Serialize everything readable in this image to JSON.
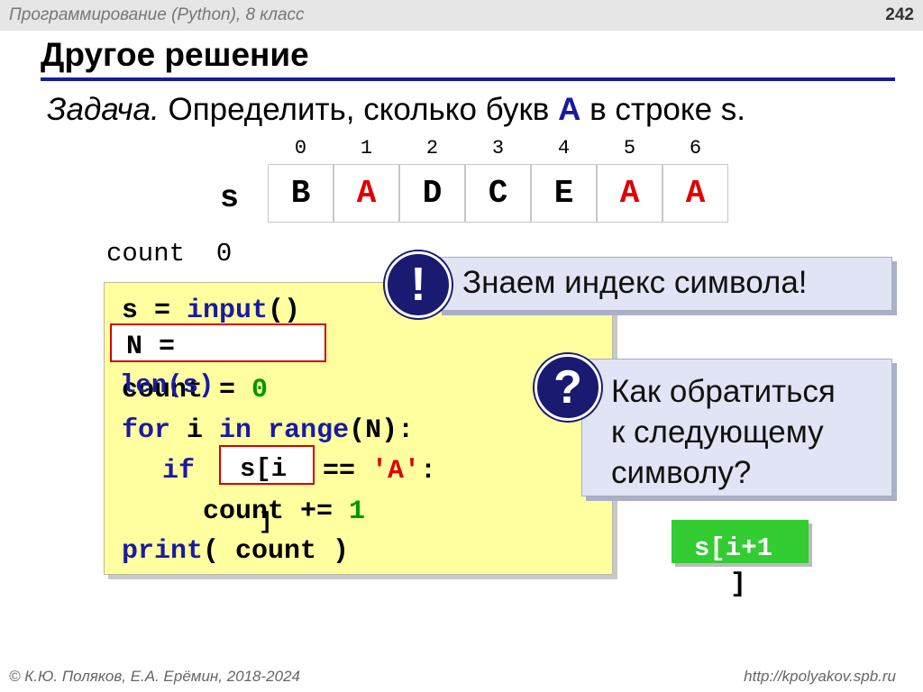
{
  "header": {
    "course": "Программирование (Python), 8 класс",
    "page_number": "242"
  },
  "slide": {
    "title": "Другое решение"
  },
  "task": {
    "lead": "Задача.",
    "text_before": "Определить, сколько букв",
    "letter": "A",
    "text_after": "в строке s."
  },
  "string_table": {
    "label": "s",
    "indices": [
      "0",
      "1",
      "2",
      "3",
      "4",
      "5",
      "6"
    ],
    "cells": [
      {
        "char": "B",
        "highlight": false
      },
      {
        "char": "A",
        "highlight": true
      },
      {
        "char": "D",
        "highlight": false
      },
      {
        "char": "C",
        "highlight": false
      },
      {
        "char": "E",
        "highlight": false
      },
      {
        "char": "A",
        "highlight": true
      },
      {
        "char": "A",
        "highlight": true
      }
    ],
    "colors": {
      "highlight": "#e00000",
      "normal": "#000000"
    }
  },
  "count_display": {
    "label": "count",
    "value": "0"
  },
  "code": {
    "l1_a": "s = ",
    "l1_b": "input",
    "l1_c": "()",
    "l2_a": "N = ",
    "l3_a": "len(s)",
    "l3_b": "count = ",
    "l3_c": "0",
    "l4_a": "for",
    "l4_b": " i ",
    "l4_c": "in",
    "l4_d": " ",
    "l4_e": "range",
    "l4_f": "(N):",
    "l5_a": "if",
    "l5_b": "s[i",
    "l5_c": "== ",
    "l5_d": "'A'",
    "l5_e": ":",
    "l6_a": "count += ",
    "l6_b": "1",
    "l6_c": "]",
    "l7_a": "print",
    "l7_b": "( count )"
  },
  "callouts": {
    "exclaim_icon": "!",
    "exclaim_text": "Знаем индекс символа!",
    "question_icon": "?",
    "question_lines": [
      "Как обратиться",
      "к следующему",
      "символу?"
    ]
  },
  "hint": {
    "text": "s[i+1",
    "close": "]"
  },
  "footer": {
    "left": "© К.Ю. Поляков, Е.А. Ерёмин, 2018-2024",
    "right": "http://kpolyakov.spb.ru"
  },
  "colors": {
    "keyword": "#1a1aa0",
    "number": "#009900",
    "string": "#e00000",
    "code_bg": "#ffffa0",
    "hint_bg": "#33cc33",
    "badge": "#1a1a70"
  }
}
